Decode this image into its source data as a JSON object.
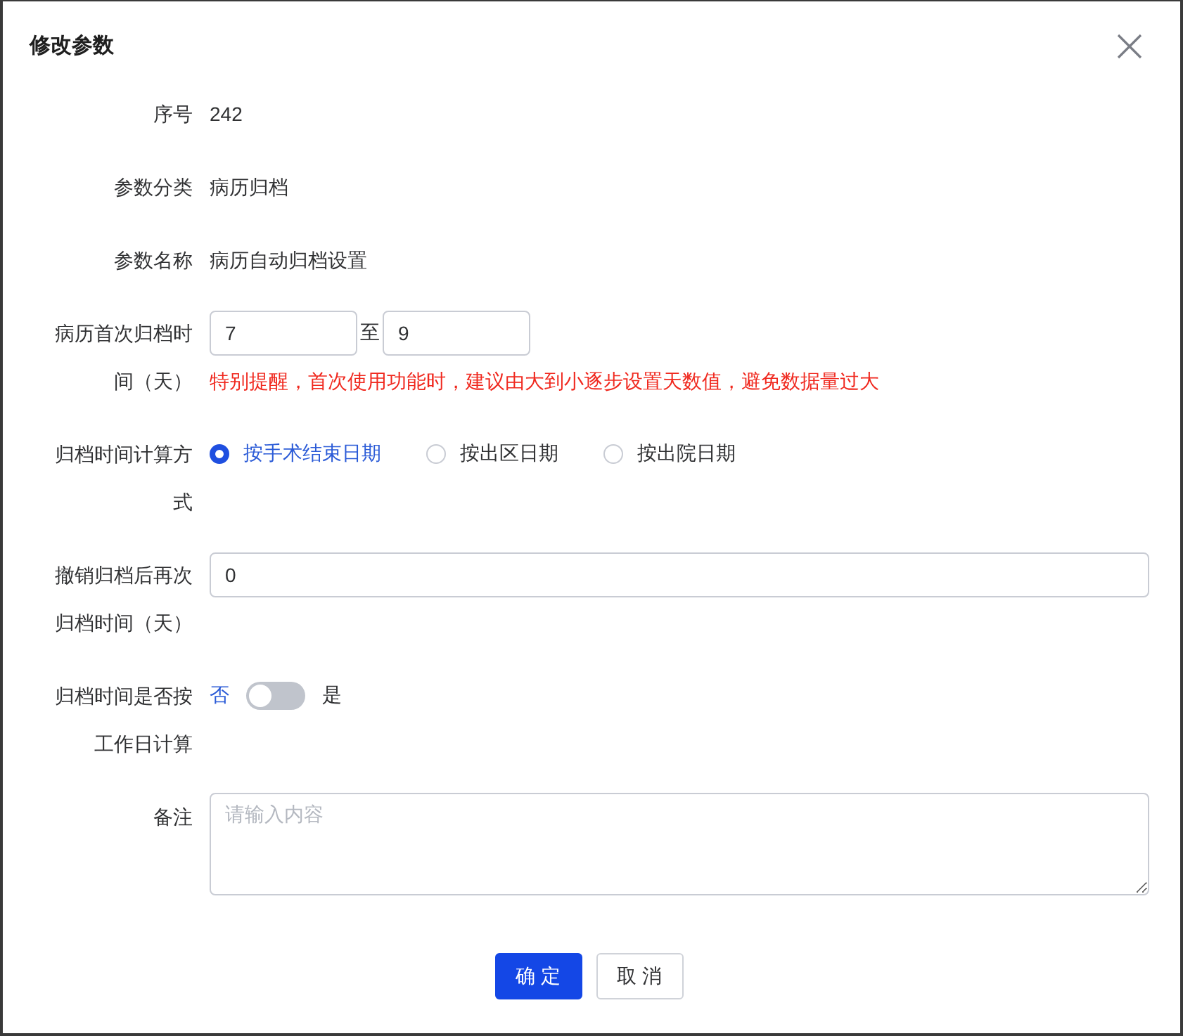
{
  "dialog": {
    "title": "修改参数"
  },
  "fields": [
    {
      "kind": "text",
      "label": "序号",
      "value": "242"
    },
    {
      "kind": "text",
      "label": "参数分类",
      "value": "病历归档"
    },
    {
      "kind": "text",
      "label": "参数名称",
      "value": "病历自动归档设置"
    },
    {
      "kind": "range",
      "label": "病历首次归档时间（天）",
      "from": "7",
      "separator": "至",
      "to": "9",
      "hint": "特别提醒，首次使用功能时，建议由大到小逐步设置天数值，避免数据量过大"
    },
    {
      "kind": "radio",
      "label": "归档时间计算方式",
      "options": [
        {
          "label": "按手术结束日期",
          "selected": true
        },
        {
          "label": "按出区日期",
          "selected": false
        },
        {
          "label": "按出院日期",
          "selected": false
        }
      ]
    },
    {
      "kind": "input",
      "label": "撤销归档后再次归档时间（天）",
      "value": "0"
    },
    {
      "kind": "switch",
      "label": "归档时间是否按工作日计算",
      "off_label": "否",
      "on_label": "是",
      "on": false
    },
    {
      "kind": "textarea",
      "label": "备注",
      "placeholder": "请输入内容"
    }
  ],
  "buttons": [
    {
      "label": "确 定",
      "kind": "primary"
    },
    {
      "label": "取 消",
      "kind": "default"
    }
  ]
}
